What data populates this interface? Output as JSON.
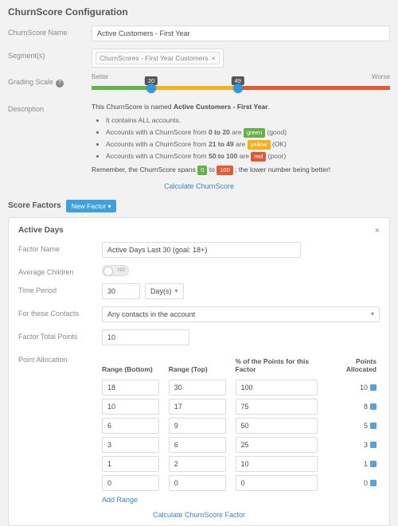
{
  "page": {
    "title": "ChurnScore Configuration"
  },
  "labels": {
    "name": "ChurnScore Name",
    "segments": "Segment(s)",
    "grading": "Grading Scale",
    "description": "Description",
    "scoreFactors": "Score Factors",
    "factorName": "Factor Name",
    "avgChildren": "Average Children",
    "timePeriod": "Time Period",
    "forContacts": "For these Contacts",
    "factorTotal": "Factor Total Points",
    "pointAlloc": "Point Allocation"
  },
  "form": {
    "name": "Active Customers - First Year",
    "segment": "ChurnScores - First Year Customers"
  },
  "slider": {
    "betterLabel": "Better",
    "worseLabel": "Worse",
    "low": 20,
    "high": 49,
    "lowPct": 20,
    "highPct": 49
  },
  "desc": {
    "line1_pre": "This ChurnScore is named ",
    "line1_bold": "Active Customers - First Year",
    "bullets": [
      {
        "text": "It contains ALL accounts."
      },
      {
        "pre": "Accounts with a ChurnScore from ",
        "range": "0 to 20",
        "post": " are ",
        "badge": "green",
        "badgeClass": "green",
        "tail": " (good)"
      },
      {
        "pre": "Accounts with a ChurnScore from ",
        "range": "21 to 49",
        "post": " are ",
        "badge": "yellow",
        "badgeClass": "yellow",
        "tail": " (OK)"
      },
      {
        "pre": "Accounts with a ChurnScore from ",
        "range": "50 to 100",
        "post": " are ",
        "badge": "red",
        "badgeClass": "red",
        "tail": " (poor)"
      }
    ],
    "remember_pre": "Remember, the ChurnScore spans ",
    "remember_low": "0",
    "remember_mid": " to ",
    "remember_high": "100",
    "remember_post": "; the lower number being better!"
  },
  "actions": {
    "calculate": "Calculate ChurnScore",
    "newFactor": "New Factor",
    "addRange": "Add Range",
    "calculateFactor": "Calculate ChurnScore Factor"
  },
  "factor": {
    "title": "Active Days",
    "name": "Active Days Last 30 (goal: 18+)",
    "toggle": "NO",
    "period": "30",
    "periodUnit": "Day(s)",
    "contacts": "Any contacts in the account",
    "totalPoints": "10",
    "cols": {
      "bottom": "Range (Bottom)",
      "top": "Range (Top)",
      "pct": "% of the Points for this Factor",
      "alloc": "Points Allocated"
    },
    "rows": [
      {
        "bottom": "18",
        "top": "30",
        "pct": "100",
        "alloc": "10"
      },
      {
        "bottom": "10",
        "top": "17",
        "pct": "75",
        "alloc": "8"
      },
      {
        "bottom": "6",
        "top": "9",
        "pct": "50",
        "alloc": "5"
      },
      {
        "bottom": "3",
        "top": "6",
        "pct": "25",
        "alloc": "3"
      },
      {
        "bottom": "1",
        "top": "2",
        "pct": "10",
        "alloc": "1"
      },
      {
        "bottom": "0",
        "top": "0",
        "pct": "0",
        "alloc": "0"
      }
    ]
  }
}
